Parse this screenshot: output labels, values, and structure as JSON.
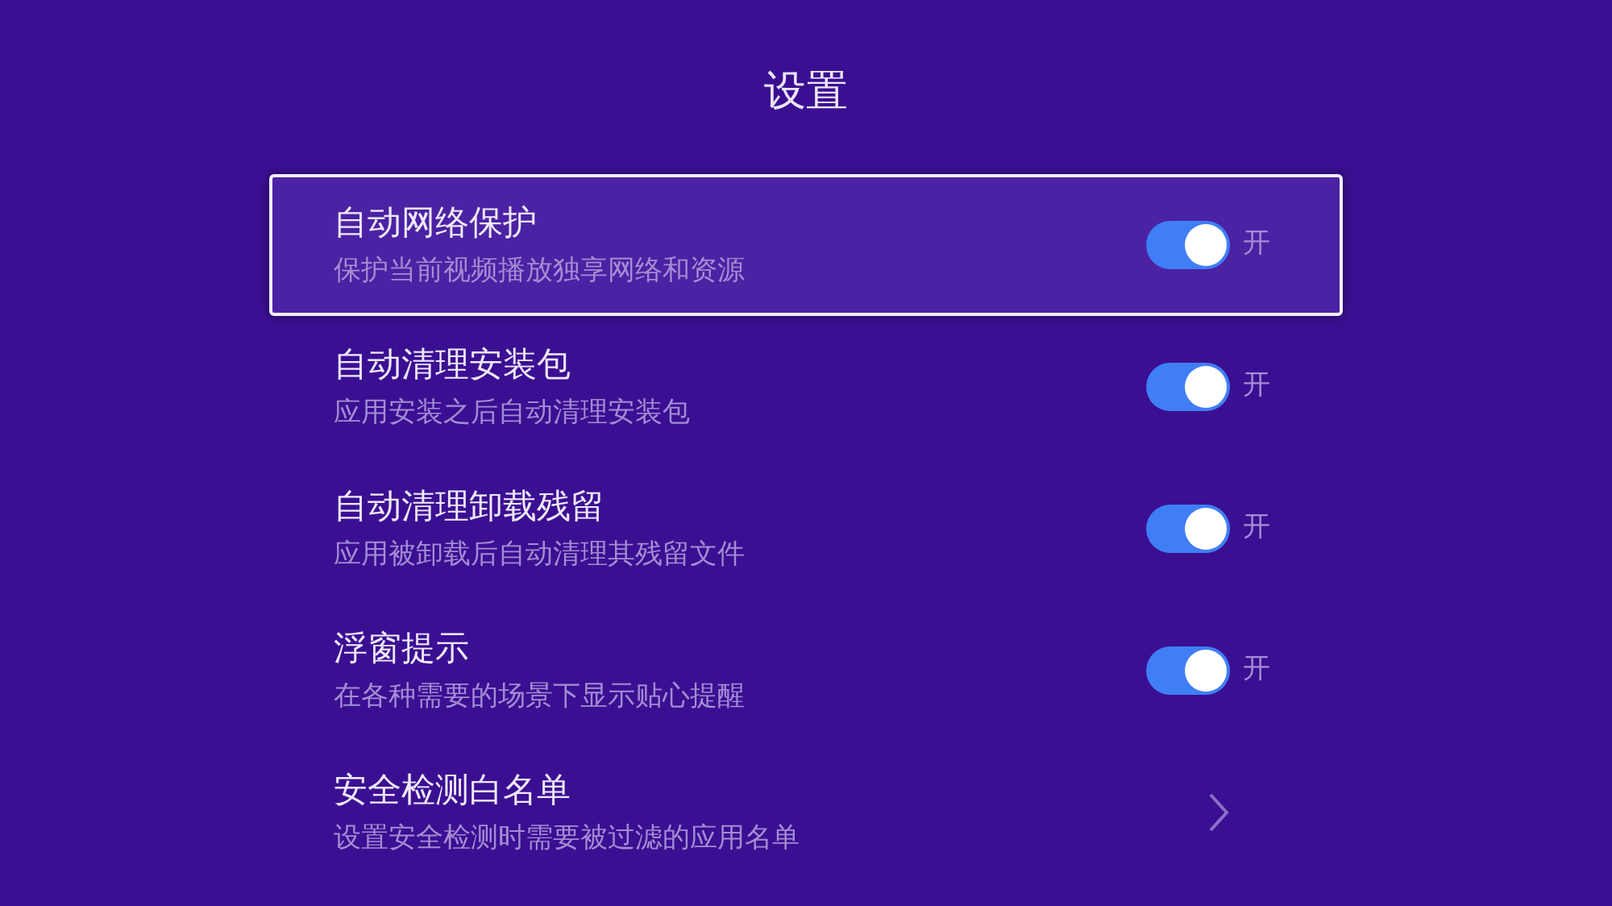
{
  "title": "设置",
  "items": [
    {
      "kind": "toggle",
      "title": "自动网络保护",
      "subtitle": "保护当前视频播放独享网络和资源",
      "on": true,
      "state_label": "开",
      "selected": true
    },
    {
      "kind": "toggle",
      "title": "自动清理安装包",
      "subtitle": "应用安装之后自动清理安装包",
      "on": true,
      "state_label": "开",
      "selected": false
    },
    {
      "kind": "toggle",
      "title": "自动清理卸载残留",
      "subtitle": "应用被卸载后自动清理其残留文件",
      "on": true,
      "state_label": "开",
      "selected": false
    },
    {
      "kind": "toggle",
      "title": "浮窗提示",
      "subtitle": "在各种需要的场景下显示贴心提醒",
      "on": true,
      "state_label": "开",
      "selected": false
    },
    {
      "kind": "link",
      "title": "安全检测白名单",
      "subtitle": "设置安全检测时需要被过滤的应用名单",
      "selected": false
    }
  ]
}
